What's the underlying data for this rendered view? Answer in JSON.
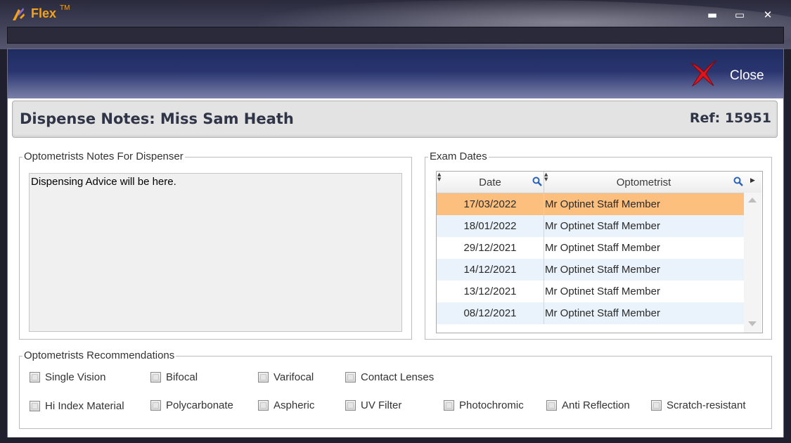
{
  "window": {
    "app_name": "Flex",
    "trademark": "TM",
    "controls": {
      "minimize": "▬",
      "maximize": "▭",
      "close": "✕"
    }
  },
  "header": {
    "close_label": "Close"
  },
  "title_panel": {
    "title": "Dispense Notes: Miss Sam Heath",
    "ref": "Ref: 15951"
  },
  "notes": {
    "legend": "Optometrists Notes For Dispenser",
    "text": "Dispensing Advice will be here."
  },
  "exam_dates": {
    "legend": "Exam Dates",
    "columns": [
      "Date",
      "Optometrist"
    ],
    "rows": [
      {
        "date": "17/03/2022",
        "optometrist": "Mr Optinet Staff Member"
      },
      {
        "date": "18/01/2022",
        "optometrist": "Mr Optinet Staff Member"
      },
      {
        "date": "29/12/2021",
        "optometrist": "Mr Optinet Staff Member"
      },
      {
        "date": "14/12/2021",
        "optometrist": "Mr Optinet Staff Member"
      },
      {
        "date": "13/12/2021",
        "optometrist": "Mr Optinet Staff Member"
      },
      {
        "date": "08/12/2021",
        "optometrist": "Mr Optinet Staff Member"
      }
    ],
    "selected_row_color": "#fdbf7e",
    "alt_row_color": "#eaf3fb"
  },
  "recommendations": {
    "legend": "Optometrists Recommendations",
    "row1": [
      "Single Vision",
      "Bifocal",
      "Varifocal",
      "Contact Lenses"
    ],
    "row2": [
      "Hi Index Material",
      "Polycarbonate",
      "Aspheric",
      "UV Filter",
      "Photochromic",
      "Anti Reflection",
      "Scratch-resistant"
    ]
  },
  "colors": {
    "brand": "#f4a21a",
    "header_band": "#1e2c60",
    "close_icon": "#e0141a"
  }
}
